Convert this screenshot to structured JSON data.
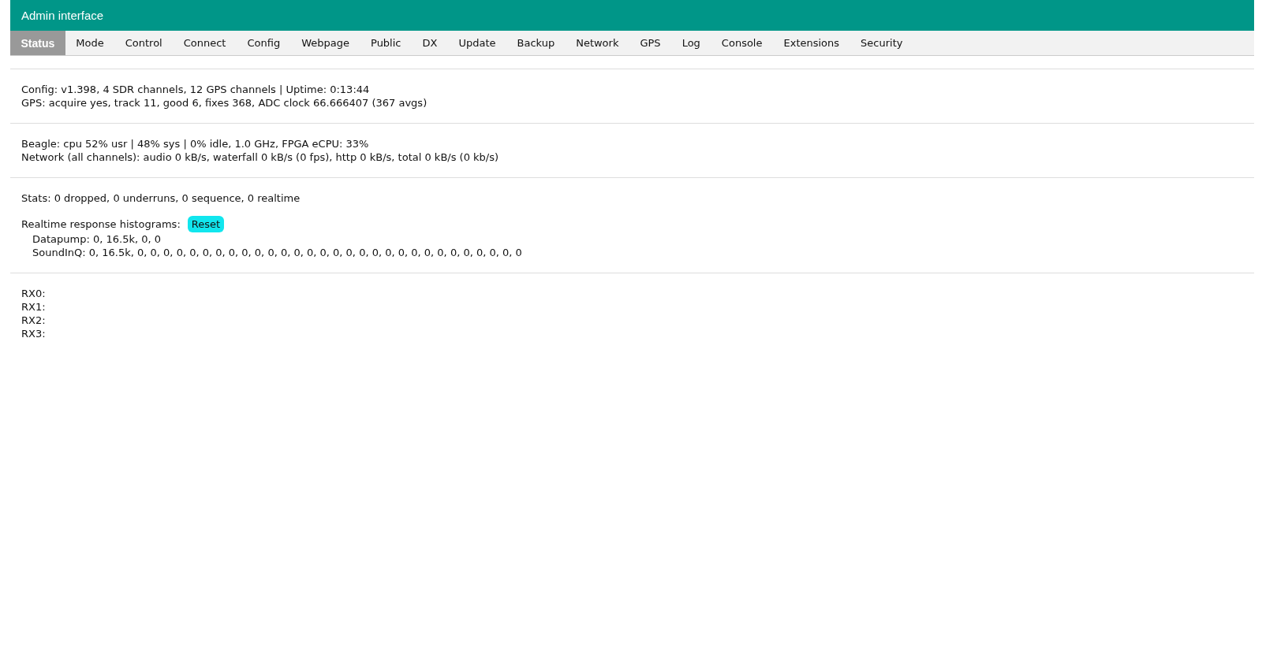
{
  "header": {
    "title": "Admin interface"
  },
  "tabs": [
    {
      "label": "Status",
      "selected": true
    },
    {
      "label": "Mode",
      "selected": false
    },
    {
      "label": "Control",
      "selected": false
    },
    {
      "label": "Connect",
      "selected": false
    },
    {
      "label": "Config",
      "selected": false
    },
    {
      "label": "Webpage",
      "selected": false
    },
    {
      "label": "Public",
      "selected": false
    },
    {
      "label": "DX",
      "selected": false
    },
    {
      "label": "Update",
      "selected": false
    },
    {
      "label": "Backup",
      "selected": false
    },
    {
      "label": "Network",
      "selected": false
    },
    {
      "label": "GPS",
      "selected": false
    },
    {
      "label": "Log",
      "selected": false
    },
    {
      "label": "Console",
      "selected": false
    },
    {
      "label": "Extensions",
      "selected": false
    },
    {
      "label": "Security",
      "selected": false
    }
  ],
  "sections": [
    {
      "rows": [
        {
          "kind": "text",
          "text": "Config: v1.398, 4 SDR channels, 12 GPS channels | Uptime: 0:13:44"
        },
        {
          "kind": "text",
          "text": "GPS: acquire yes, track 11, good 6, fixes 368, ADC clock 66.666407 (367 avgs)"
        }
      ]
    },
    {
      "rows": [
        {
          "kind": "text",
          "text": "Beagle: cpu 52% usr | 48% sys | 0% idle, 1.0 GHz, FPGA eCPU: 33%"
        },
        {
          "kind": "text",
          "text": "Network (all channels): audio 0 kB/s, waterfall 0 kB/s (0 fps), http 0 kB/s, total 0 kB/s (0 kb/s)"
        }
      ]
    },
    {
      "rows": [
        {
          "kind": "text",
          "text": "Stats: 0 dropped, 0 underruns, 0 sequence, 0 realtime"
        },
        {
          "kind": "button",
          "text": "Realtime response histograms:",
          "button": "Reset"
        },
        {
          "kind": "indent",
          "text": "Datapump: 0, 16.5k, 0, 0"
        },
        {
          "kind": "indent",
          "text": "SoundInQ: 0, 16.5k, 0, 0, 0, 0, 0, 0, 0, 0, 0, 0, 0, 0, 0, 0, 0, 0, 0, 0, 0, 0, 0, 0, 0, 0, 0, 0, 0, 0, 0, 0"
        }
      ]
    },
    {
      "rows": [
        {
          "kind": "text",
          "text": "RX0:"
        },
        {
          "kind": "text",
          "text": "RX1:"
        },
        {
          "kind": "text",
          "text": "RX2:"
        },
        {
          "kind": "text",
          "text": "RX3:"
        }
      ]
    }
  ]
}
